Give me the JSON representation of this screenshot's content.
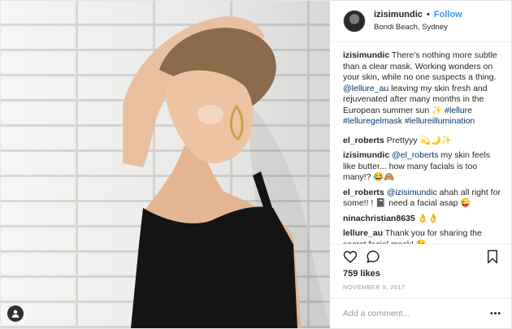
{
  "header": {
    "username": "izisimundic",
    "separator": "•",
    "follow_label": "Follow",
    "location": "Bondi Beach, Sydney"
  },
  "caption": {
    "user": "izisimundic",
    "text_1": "There's nothing more subtle than a clear mask. Working wonders on your skin, while no one suspects a thing.",
    "mention": "@lellure_au",
    "text_2": "leaving my skin fresh and rejuvenated after many months in the European summer sun ✨",
    "hashtags": "#lellure #lelluregelmask #lellureillumination"
  },
  "comments": [
    {
      "user": "el_roberts",
      "mention": "",
      "text": "Prettyyy 💫🌙✨"
    },
    {
      "user": "izisimundic",
      "mention": "@el_roberts",
      "text": "my skin feels like butter... how many facials is too many!? 😂🙈"
    },
    {
      "user": "el_roberts",
      "mention": "@izisimundic",
      "text": "ahah all right for some!! ! 📓 need a facial asap 😜"
    },
    {
      "user": "ninachristian8635",
      "mention": "",
      "text": "👌👌"
    },
    {
      "user": "lellure_au",
      "mention": "",
      "text": "Thank you for sharing the secret facial mask! 😉"
    }
  ],
  "likes": "759 likes",
  "date": "NOVEMBER 9, 2017",
  "add_comment_placeholder": "Add a comment...",
  "more_label": "•••",
  "icons": {
    "like": "heart-icon",
    "comment": "speech-bubble-icon",
    "save": "bookmark-icon",
    "user_tag": "person-tag-icon"
  },
  "colors": {
    "follow": "#3897f0",
    "link": "#003569",
    "text": "#262626",
    "muted": "#999999"
  }
}
